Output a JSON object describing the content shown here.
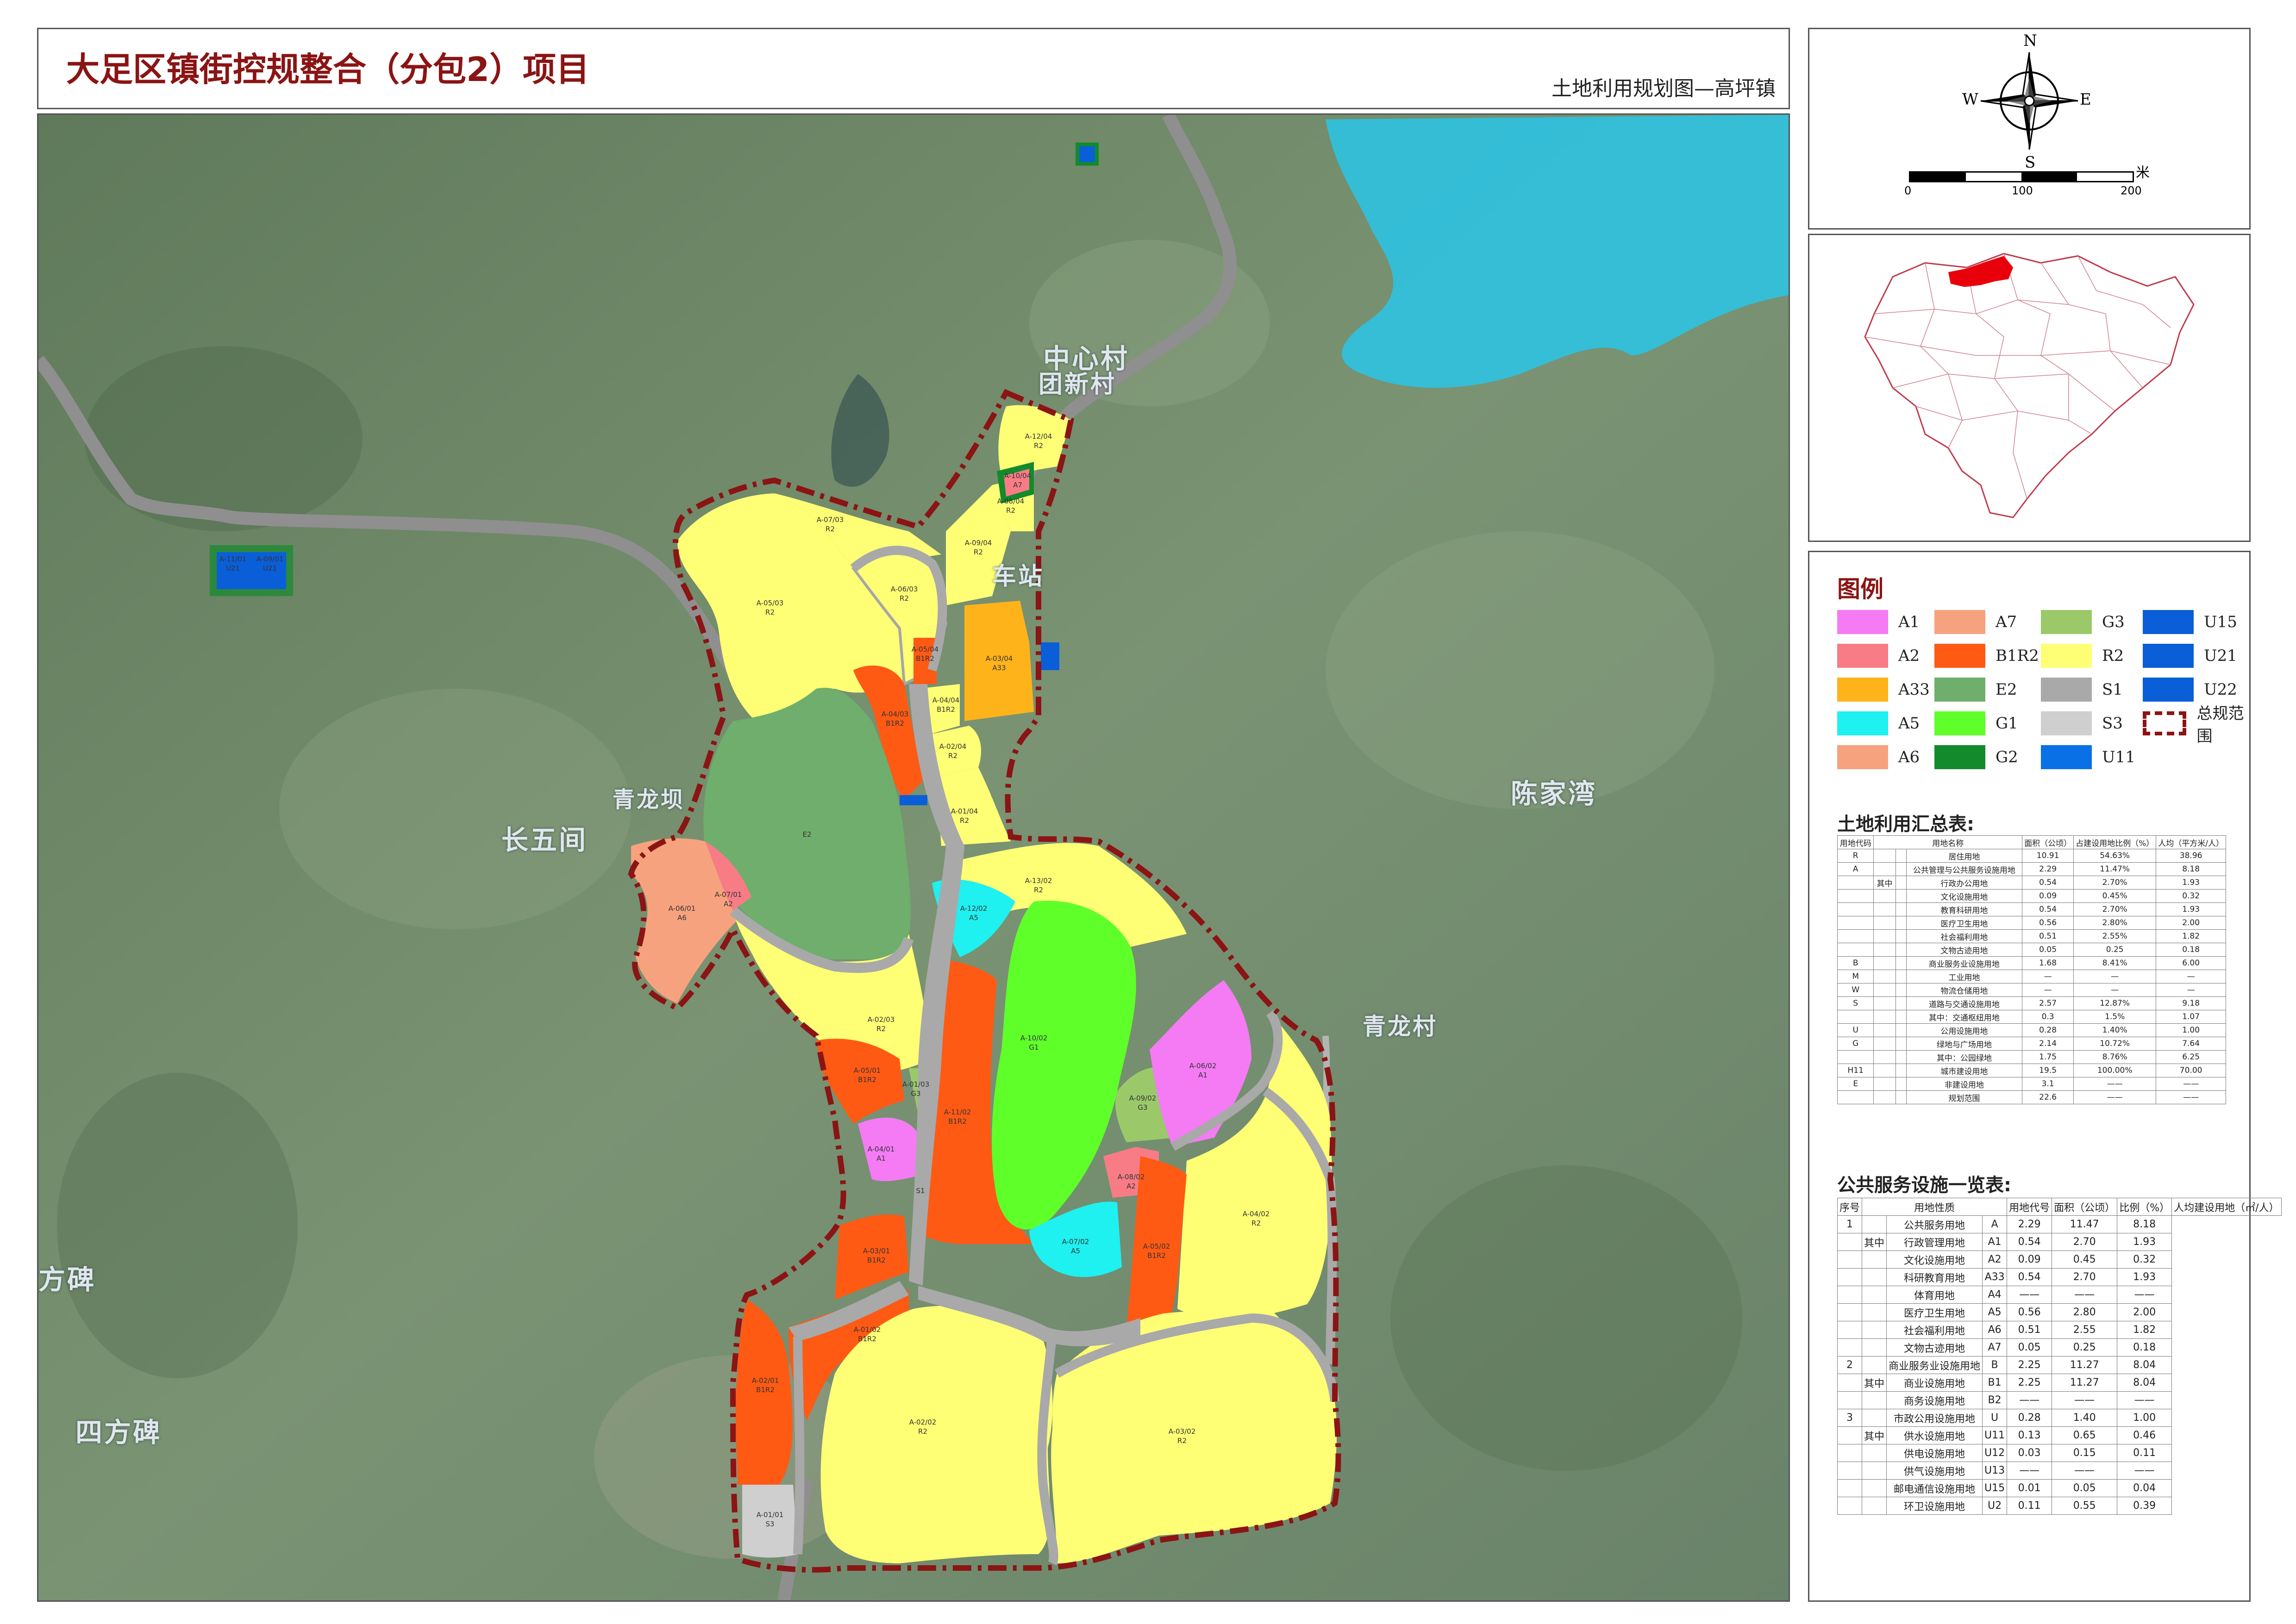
{
  "header": {
    "title": "大足区镇街控规整合（分包2）项目",
    "subtitle": "土地利用规划图—高坪镇"
  },
  "compass": {
    "n": "N",
    "s": "S",
    "e": "E",
    "w": "W"
  },
  "scale_bar": {
    "unit": "米",
    "labels": [
      "0",
      "100",
      "200"
    ]
  },
  "locator": {
    "highlight_color": "#e8000b"
  },
  "legend": {
    "title": "图例",
    "items": [
      {
        "code": "A1",
        "color": "#f47bf4"
      },
      {
        "code": "A7",
        "color": "#f7a27e"
      },
      {
        "code": "G3",
        "color": "#9bc96a"
      },
      {
        "code": "U15",
        "color": "#0a5fd8"
      },
      {
        "code": "A2",
        "color": "#f77c86"
      },
      {
        "code": "B1R2",
        "color": "#ff5a14"
      },
      {
        "code": "R2",
        "color": "#ffff75"
      },
      {
        "code": "U21",
        "color": "#0a5fd8"
      },
      {
        "code": "A33",
        "color": "#ffb31a"
      },
      {
        "code": "E2",
        "color": "#6fae6c"
      },
      {
        "code": "S1",
        "color": "#a9a9a9"
      },
      {
        "code": "U22",
        "color": "#0a5fd8"
      },
      {
        "code": "A5",
        "color": "#1ff0f0"
      },
      {
        "code": "G1",
        "color": "#5fff2a"
      },
      {
        "code": "S3",
        "color": "#cfcfcf"
      },
      {
        "code": "总规范围",
        "color": "#8b1414"
      },
      {
        "code": "A6",
        "color": "#f7a27e"
      },
      {
        "code": "G2",
        "color": "#138a2b"
      },
      {
        "code": "U11",
        "color": "#0a70e6"
      }
    ]
  },
  "landuse_summary": {
    "title": "土地利用汇总表:",
    "headers": [
      "用地代码",
      "用地名称",
      "面积（公顷）",
      "占建设用地比例（%）",
      "人均（平方米/人）"
    ],
    "rows": [
      [
        "R",
        "",
        "",
        "居住用地",
        "10.91",
        "54.63%",
        "38.96"
      ],
      [
        "A",
        "",
        "",
        "公共管理与公共服务设施用地",
        "2.29",
        "11.47%",
        "8.18"
      ],
      [
        "",
        "其中",
        "",
        "行政办公用地",
        "0.54",
        "2.70%",
        "1.93"
      ],
      [
        "",
        "",
        "",
        "文化设施用地",
        "0.09",
        "0.45%",
        "0.32"
      ],
      [
        "",
        "",
        "",
        "教育科研用地",
        "0.54",
        "2.70%",
        "1.93"
      ],
      [
        "",
        "",
        "",
        "医疗卫生用地",
        "0.56",
        "2.80%",
        "2.00"
      ],
      [
        "",
        "",
        "",
        "社会福利用地",
        "0.51",
        "2.55%",
        "1.82"
      ],
      [
        "",
        "",
        "",
        "文物古迹用地",
        "0.05",
        "0.25",
        "0.18"
      ],
      [
        "B",
        "",
        "",
        "商业服务业设施用地",
        "1.68",
        "8.41%",
        "6.00"
      ],
      [
        "M",
        "",
        "",
        "工业用地",
        "—",
        "—",
        "—"
      ],
      [
        "W",
        "",
        "",
        "物流仓储用地",
        "—",
        "—",
        "—"
      ],
      [
        "S",
        "",
        "",
        "道路与交通设施用地",
        "2.57",
        "12.87%",
        "9.18"
      ],
      [
        "",
        "",
        "",
        "其中：交通枢纽用地",
        "0.3",
        "1.5%",
        "1.07"
      ],
      [
        "U",
        "",
        "",
        "公用设施用地",
        "0.28",
        "1.40%",
        "1.00"
      ],
      [
        "G",
        "",
        "",
        "绿地与广场用地",
        "2.14",
        "10.72%",
        "7.64"
      ],
      [
        "",
        "",
        "",
        "其中：公园绿地",
        "1.75",
        "8.76%",
        "6.25"
      ],
      [
        "H11",
        "",
        "",
        "城市建设用地",
        "19.5",
        "100.00%",
        "70.00"
      ],
      [
        "E",
        "",
        "",
        "非建设用地",
        "3.1",
        "——",
        "——"
      ],
      [
        "",
        "",
        "",
        "规划范围",
        "22.6",
        "——",
        "——"
      ]
    ]
  },
  "facility_table": {
    "title": "公共服务设施一览表:",
    "headers": [
      "序号",
      "用地性质",
      "用地代号",
      "面积（公顷）",
      "比例（%）",
      "人均建设用地（㎡/人）"
    ],
    "rows": [
      [
        "1",
        "",
        "公共服务用地",
        "A",
        "2.29",
        "11.47",
        "8.18"
      ],
      [
        "",
        "其中",
        "行政管理用地",
        "A1",
        "0.54",
        "2.70",
        "1.93"
      ],
      [
        "",
        "",
        "文化设施用地",
        "A2",
        "0.09",
        "0.45",
        "0.32"
      ],
      [
        "",
        "",
        "科研教育用地",
        "A33",
        "0.54",
        "2.70",
        "1.93"
      ],
      [
        "",
        "",
        "体育用地",
        "A4",
        "——",
        "——",
        "——"
      ],
      [
        "",
        "",
        "医疗卫生用地",
        "A5",
        "0.56",
        "2.80",
        "2.00"
      ],
      [
        "",
        "",
        "社会福利用地",
        "A6",
        "0.51",
        "2.55",
        "1.82"
      ],
      [
        "",
        "",
        "文物古迹用地",
        "A7",
        "0.05",
        "0.25",
        "0.18"
      ],
      [
        "2",
        "",
        "商业服务业设施用地",
        "B",
        "2.25",
        "11.27",
        "8.04"
      ],
      [
        "",
        "其中",
        "商业设施用地",
        "B1",
        "2.25",
        "11.27",
        "8.04"
      ],
      [
        "",
        "",
        "商务设施用地",
        "B2",
        "——",
        "——",
        "——"
      ],
      [
        "3",
        "",
        "市政公用设施用地",
        "U",
        "0.28",
        "1.40",
        "1.00"
      ],
      [
        "",
        "其中",
        "供水设施用地",
        "U11",
        "0.13",
        "0.65",
        "0.46"
      ],
      [
        "",
        "",
        "供电设施用地",
        "U12",
        "0.03",
        "0.15",
        "0.11"
      ],
      [
        "",
        "",
        "供气设施用地",
        "U13",
        "——",
        "——",
        "——"
      ],
      [
        "",
        "",
        "邮电通信设施用地",
        "U15",
        "0.01",
        "0.05",
        "0.04"
      ],
      [
        "",
        "",
        "环卫设施用地",
        "U2",
        "0.11",
        "0.55",
        "0.39"
      ]
    ]
  },
  "place_names": [
    "中心村",
    "团新村",
    "长五间",
    "青龙坝",
    "陈家湾",
    "青龙村",
    "四方碑",
    "方碑",
    "车站"
  ],
  "parcels": [
    {
      "id": "A-05/03",
      "code": "R2"
    },
    {
      "id": "A-06/03",
      "code": "R2"
    },
    {
      "id": "A-07/03",
      "code": "R2"
    },
    {
      "id": "A-04/03",
      "code": "B1R2"
    },
    {
      "id": "A-05/04",
      "code": "B1R2"
    },
    {
      "id": "A-03/04",
      "code": "A33"
    },
    {
      "id": "A-04/04",
      "code": "B1R2"
    },
    {
      "id": "A-02/04",
      "code": "R2"
    },
    {
      "id": "A-01/04",
      "code": "R2"
    },
    {
      "id": "A-09/04",
      "code": "R2"
    },
    {
      "id": "A-08/04",
      "code": "R2"
    },
    {
      "id": "A-10/04",
      "code": "A7"
    },
    {
      "id": "A-12/04",
      "code": "R2"
    },
    {
      "id": "E2",
      "code": "E2"
    },
    {
      "id": "A-07/01",
      "code": "A2"
    },
    {
      "id": "A-06/01",
      "code": "A6"
    },
    {
      "id": "A-02/03",
      "code": "R2"
    },
    {
      "id": "A-01/03",
      "code": "G3"
    },
    {
      "id": "A-13/02",
      "code": "R2"
    },
    {
      "id": "A-12/02",
      "code": "A5"
    },
    {
      "id": "A-10/02",
      "code": "G1"
    },
    {
      "id": "A-11/02",
      "code": "B1R2"
    },
    {
      "id": "A-09/02",
      "code": "G3"
    },
    {
      "id": "A-06/02",
      "code": "A1"
    },
    {
      "id": "A-04/02",
      "code": "R2"
    },
    {
      "id": "A-08/02",
      "code": "A2"
    },
    {
      "id": "A-07/02",
      "code": "A5"
    },
    {
      "id": "A-05/02",
      "code": "B1R2"
    },
    {
      "id": "A-05/01",
      "code": "B1R2"
    },
    {
      "id": "A-04/01",
      "code": "A1"
    },
    {
      "id": "A-03/01",
      "code": "B1R2"
    },
    {
      "id": "A-01/02",
      "code": "B1R2"
    },
    {
      "id": "A-02/01",
      "code": "B1R2"
    },
    {
      "id": "A-01/01",
      "code": "S3"
    },
    {
      "id": "A-02/02",
      "code": "R2"
    },
    {
      "id": "A-03/02",
      "code": "R2"
    },
    {
      "id": "S1",
      "code": "S1"
    },
    {
      "id": "A-11/01",
      "code": "U21"
    },
    {
      "id": "A-09/01",
      "code": "U21"
    }
  ]
}
